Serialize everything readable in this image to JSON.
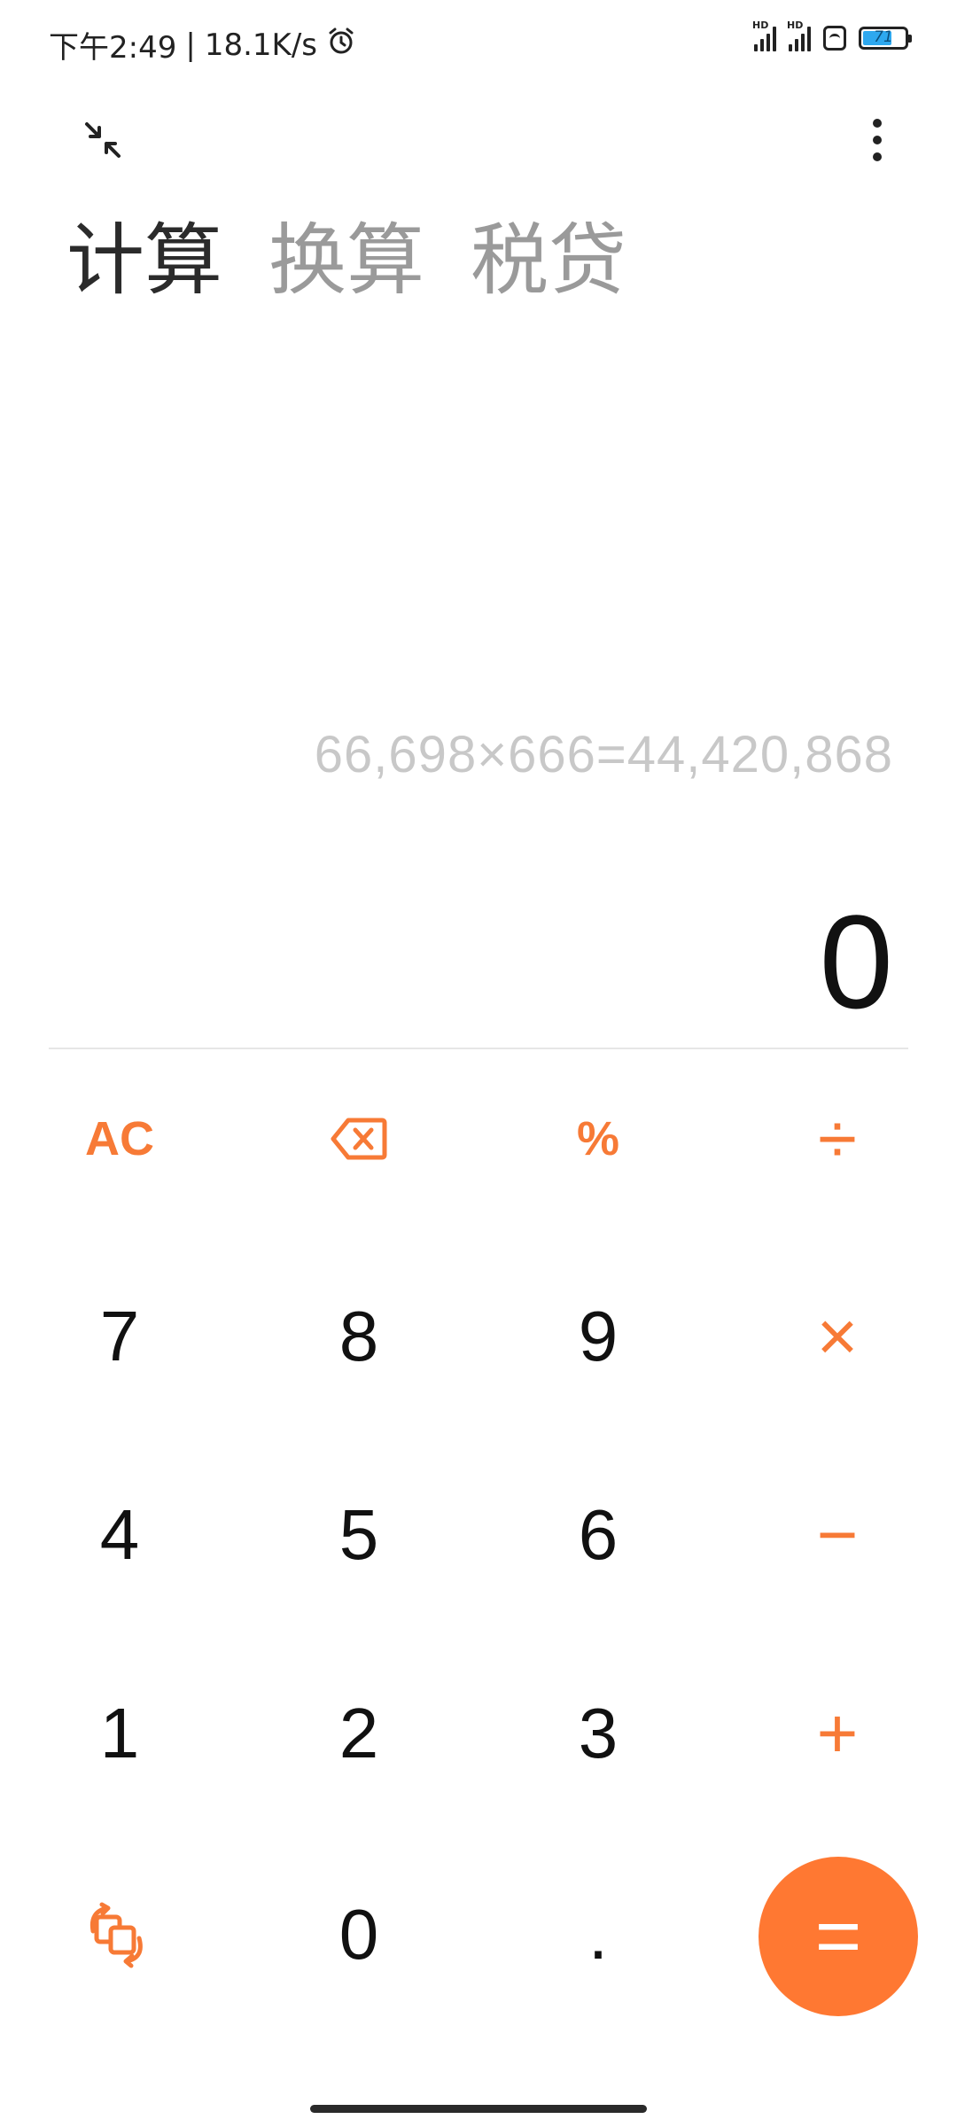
{
  "status_bar": {
    "time": "下午2:49",
    "separator": "|",
    "speed": "18.1K/s",
    "signal_badge": "HD",
    "battery_level": "71",
    "battery_fraction": 0.71,
    "icons": [
      "alarm-icon",
      "signal-icon",
      "signal-icon",
      "wifi-icon",
      "battery-icon"
    ]
  },
  "top": {
    "collapse_icon": "collapse-arrows-icon",
    "more_icon": "more-vertical-icon"
  },
  "tabs": [
    {
      "label": "计算",
      "active": true
    },
    {
      "label": "换算",
      "active": false
    },
    {
      "label": "税贷",
      "active": false
    }
  ],
  "display": {
    "expression": "66,698×666=44,420,868",
    "result": "0"
  },
  "keypad": {
    "row1": [
      "AC",
      "⌫",
      "%",
      "÷"
    ],
    "row2": [
      "7",
      "8",
      "9",
      "×"
    ],
    "row3": [
      "4",
      "5",
      "6",
      "−"
    ],
    "row4": [
      "1",
      "2",
      "3",
      "+"
    ],
    "row5": [
      "switch",
      "0",
      ".",
      "="
    ]
  },
  "colors": {
    "accent": "#ff7832",
    "operator": "#f77a36",
    "text": "#111111",
    "muted": "#9a9a9a",
    "expression": "#c8c8c8"
  }
}
